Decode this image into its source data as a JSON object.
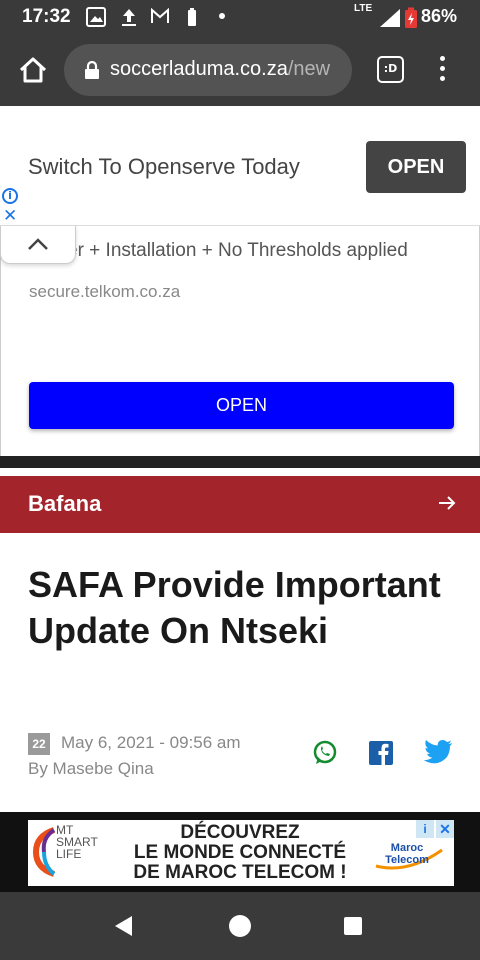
{
  "status_bar": {
    "time": "17:32",
    "network": "LTE",
    "battery_percent": "86%",
    "icons": [
      "image-icon",
      "upload-icon",
      "gmail-icon",
      "battery-small-icon",
      "dot-icon",
      "signal-icon",
      "battery-icon"
    ]
  },
  "browser": {
    "url_domain": "soccerladuma.co.za",
    "url_path": "/new",
    "tabs_label": ":D"
  },
  "top_ad": {
    "headline": "Switch To Openserve Today",
    "button_label": "OPEN",
    "body_text": "er + Installation + No Thresholds applied",
    "domain": "secure.telkom.co.za",
    "cta_label": "OPEN",
    "accent_color": "#0000ff"
  },
  "category": {
    "label": "Bafana",
    "color": "#a3252b"
  },
  "article": {
    "title": "SAFA Provide Important Update On Ntseki",
    "date_badge": "22",
    "date": "May 6, 2021 - 09:56 am",
    "author": "By Masebe Qina"
  },
  "share": {
    "whatsapp_color": "#128c2e",
    "facebook_color": "#1a5fa8",
    "twitter_color": "#1da1f2"
  },
  "bottom_ad": {
    "mt_lines": [
      "MT",
      "SMART",
      "LIFE"
    ],
    "main_lines": [
      "DÉCOUVREZ",
      "LE MONDE CONNECTÉ",
      "DE MAROC TELECOM !"
    ],
    "brand_lines": [
      "Maroc",
      "Telecom"
    ]
  }
}
